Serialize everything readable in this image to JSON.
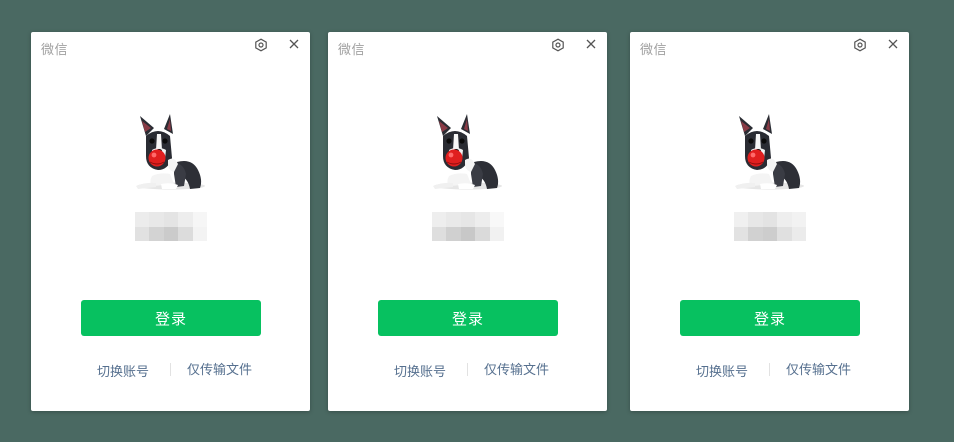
{
  "colors": {
    "desktop_background": "#4a6962",
    "login_button": "#07c160",
    "link_text": "#56708f"
  },
  "windows": [
    {
      "title": "微信",
      "settings_icon": "settings-hexagon-icon",
      "close_icon": "close-icon",
      "avatar": "boston-terrier-with-red-ball",
      "nickname": "",
      "login_label": "登录",
      "switch_account_label": "切换账号",
      "file_transfer_label": "仅传输文件"
    },
    {
      "title": "微信",
      "settings_icon": "settings-hexagon-icon",
      "close_icon": "close-icon",
      "avatar": "boston-terrier-with-red-ball",
      "nickname": "",
      "login_label": "登录",
      "switch_account_label": "切换账号",
      "file_transfer_label": "仅传输文件"
    },
    {
      "title": "微信",
      "settings_icon": "settings-hexagon-icon",
      "close_icon": "close-icon",
      "avatar": "boston-terrier-with-red-ball",
      "nickname": "",
      "login_label": "登录",
      "switch_account_label": "切换账号",
      "file_transfer_label": "仅传输文件"
    }
  ]
}
